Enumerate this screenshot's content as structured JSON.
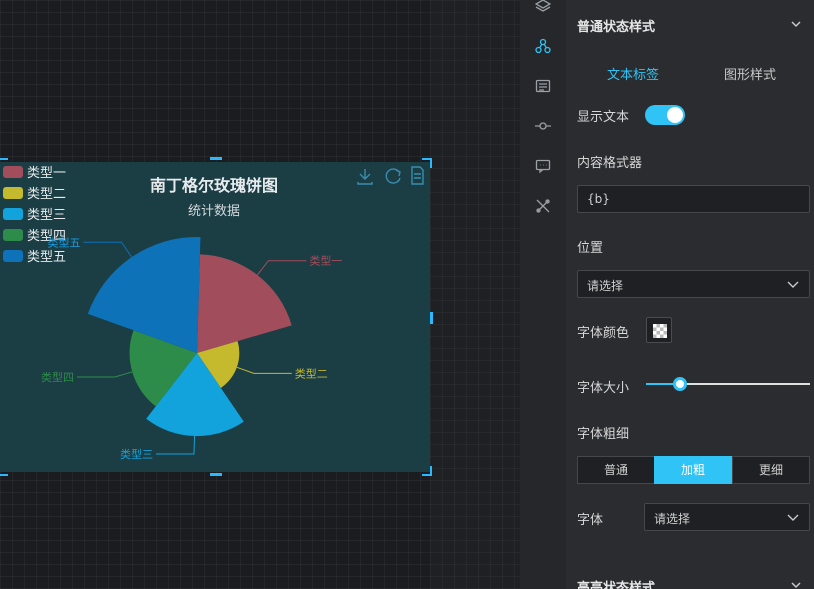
{
  "chart": {
    "title": "南丁格尔玫瑰饼图",
    "subtitle": "统计数据",
    "legend": [
      "类型一",
      "类型二",
      "类型三",
      "类型四",
      "类型五"
    ],
    "toolbox": [
      "download-icon",
      "refresh-icon",
      "data-view-icon"
    ]
  },
  "chart_data": {
    "type": "pie",
    "rose_type": "radius",
    "title": "南丁格尔玫瑰饼图",
    "subtitle": "统计数据",
    "categories": [
      "类型一",
      "类型二",
      "类型三",
      "类型四",
      "类型五"
    ],
    "values": [
      100,
      35,
      82,
      64,
      120
    ],
    "colors": [
      "#a24d5c",
      "#c5b92e",
      "#12a3dc",
      "#2e8c4a",
      "#0e72b8"
    ],
    "legend_position": "top-left",
    "label_position": "outside"
  },
  "sidebar_icons": [
    "layers-icon",
    "nodes-icon",
    "list-icon",
    "connector-icon",
    "message-icon",
    "tools-icon"
  ],
  "panel": {
    "section_normal": "普通状态样式",
    "tabs": {
      "text_label": "文本标签",
      "shape_style": "图形样式"
    },
    "show_text_label": "显示文本",
    "show_text_on": true,
    "formatter_label": "内容格式器",
    "formatter_value": "{b}",
    "position_label": "位置",
    "position_value": "请选择",
    "font_color_label": "字体颜色",
    "font_size_label": "字体大小",
    "font_size_level": 0.21,
    "font_weight_label": "字体粗细",
    "font_weight_options": [
      "普通",
      "加粗",
      "更细"
    ],
    "font_weight_selected": "加粗",
    "font_family_label": "字体",
    "font_family_value": "请选择",
    "section_highlight": "高亮状态样式"
  },
  "colors": {
    "accent": "#2fc4f5",
    "chart_bg": "#1b3d44",
    "panel_bg": "#2b2c30"
  }
}
